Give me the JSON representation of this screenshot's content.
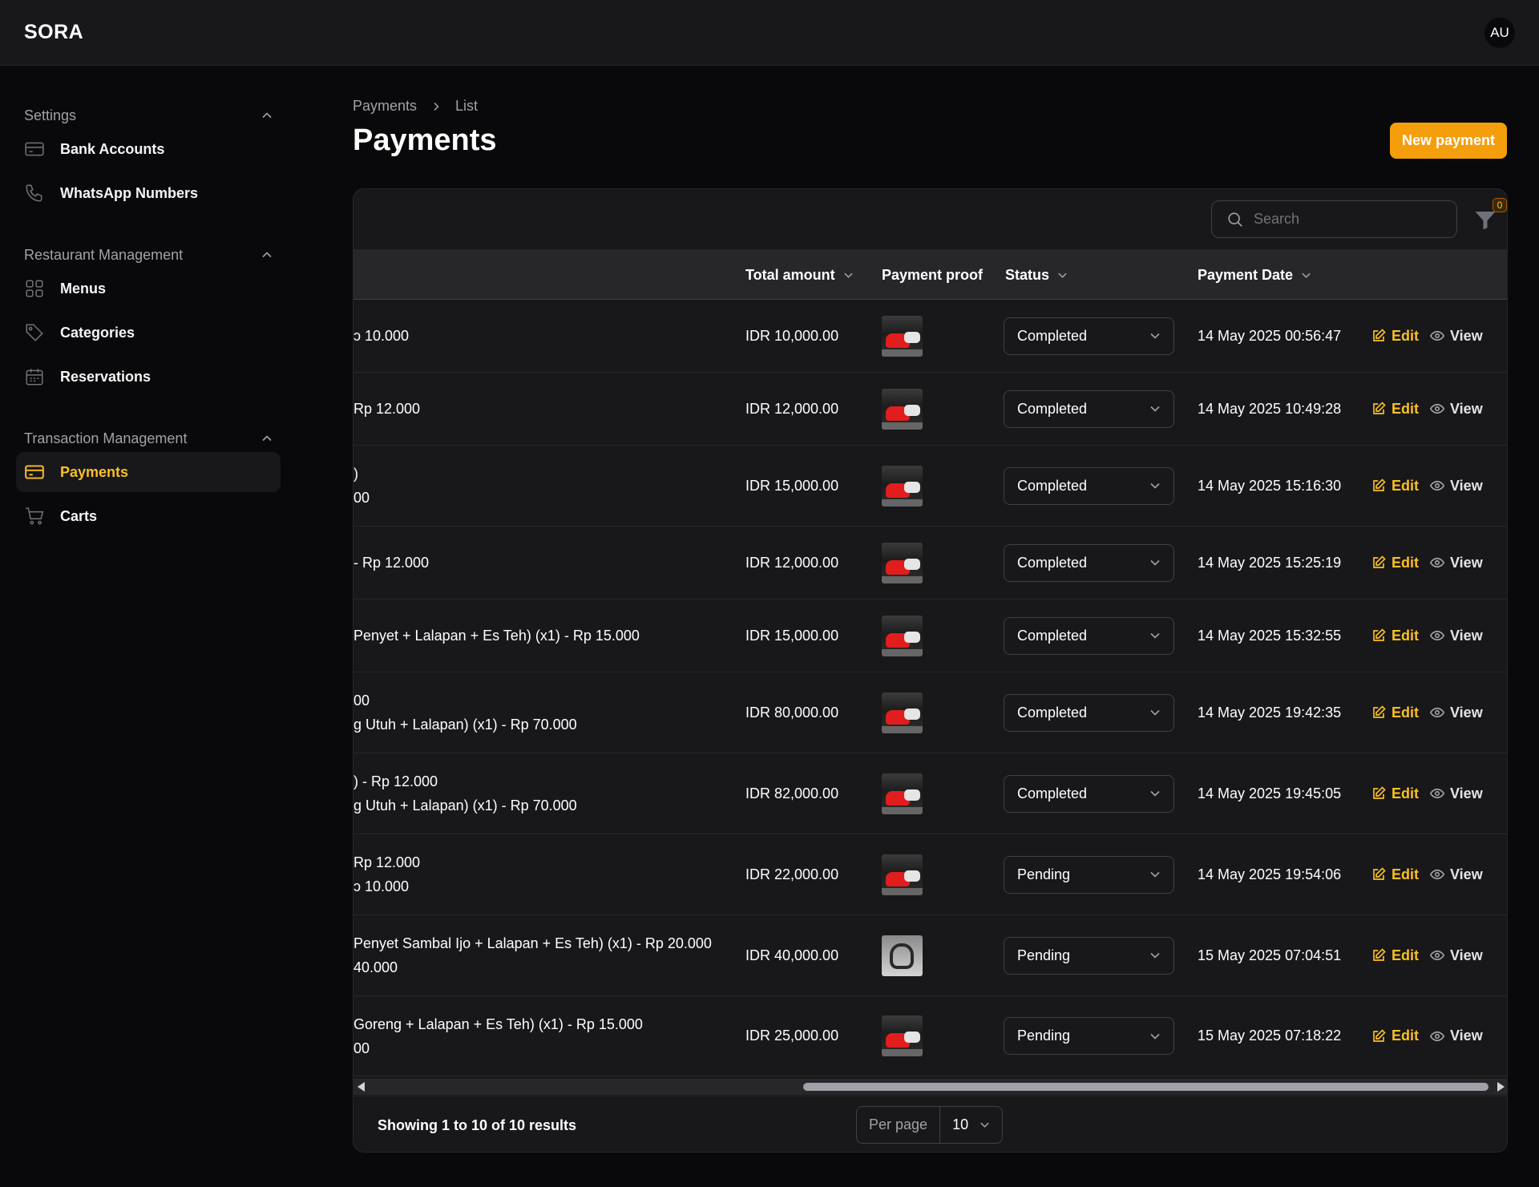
{
  "app": {
    "brand": "SORA",
    "user_initials": "AU"
  },
  "sidebar": {
    "groups": [
      {
        "label": "Settings",
        "items": [
          {
            "label": "Bank Accounts",
            "icon": "credit-card-icon"
          },
          {
            "label": "WhatsApp Numbers",
            "icon": "phone-icon"
          }
        ]
      },
      {
        "label": "Restaurant Management",
        "items": [
          {
            "label": "Menus",
            "icon": "grid-icon"
          },
          {
            "label": "Categories",
            "icon": "tag-icon"
          },
          {
            "label": "Reservations",
            "icon": "calendar-icon"
          }
        ]
      },
      {
        "label": "Transaction Management",
        "items": [
          {
            "label": "Payments",
            "icon": "credit-card-icon",
            "active": true
          },
          {
            "label": "Carts",
            "icon": "shopping-cart-icon"
          }
        ]
      }
    ]
  },
  "breadcrumb": {
    "parent": "Payments",
    "current": "List"
  },
  "page": {
    "title": "Payments",
    "new_button": "New payment"
  },
  "table": {
    "search_placeholder": "Search",
    "filter_count": "0",
    "columns": {
      "total_amount": "Total amount",
      "payment_proof": "Payment proof",
      "status": "Status",
      "payment_date": "Payment Date"
    },
    "actions": {
      "edit": "Edit",
      "view": "View"
    },
    "rows": [
      {
        "items": [
          "ɔ 10.000"
        ],
        "total": "IDR 10,000.00",
        "status": "Completed",
        "date": "14 May 2025 00:56:47",
        "proof": "car"
      },
      {
        "items": [
          "Rp 12.000"
        ],
        "total": "IDR 12,000.00",
        "status": "Completed",
        "date": "14 May 2025 10:49:28",
        "proof": "car"
      },
      {
        "items": [
          ")",
          "00"
        ],
        "total": "IDR 15,000.00",
        "status": "Completed",
        "date": "14 May 2025 15:16:30",
        "proof": "car"
      },
      {
        "items": [
          "- Rp 12.000"
        ],
        "total": "IDR 12,000.00",
        "status": "Completed",
        "date": "14 May 2025 15:25:19",
        "proof": "car"
      },
      {
        "items": [
          "Penyet + Lalapan + Es Teh) (x1) - Rp 15.000"
        ],
        "total": "IDR 15,000.00",
        "status": "Completed",
        "date": "14 May 2025 15:32:55",
        "proof": "car"
      },
      {
        "items": [
          "00",
          "g Utuh + Lalapan) (x1) - Rp 70.000"
        ],
        "total": "IDR 80,000.00",
        "status": "Completed",
        "date": "14 May 2025 19:42:35",
        "proof": "car"
      },
      {
        "items": [
          ") - Rp 12.000",
          "g Utuh + Lalapan) (x1) - Rp 70.000"
        ],
        "total": "IDR 82,000.00",
        "status": "Completed",
        "date": "14 May 2025 19:45:05",
        "proof": "car"
      },
      {
        "items": [
          "Rp 12.000",
          "ɔ 10.000"
        ],
        "total": "IDR 22,000.00",
        "status": "Pending",
        "date": "14 May 2025 19:54:06",
        "proof": "car"
      },
      {
        "items": [
          "Penyet Sambal Ijo + Lalapan + Es Teh) (x1) - Rp 20.000",
          "40.000"
        ],
        "total": "IDR 40,000.00",
        "status": "Pending",
        "date": "15 May 2025 07:04:51",
        "proof": "motorcycle"
      },
      {
        "items": [
          "Goreng + Lalapan + Es Teh) (x1) - Rp 15.000",
          "00"
        ],
        "total": "IDR 25,000.00",
        "status": "Pending",
        "date": "15 May 2025 07:18:22",
        "proof": "car"
      }
    ],
    "summary": "Showing 1 to 10 of 10 results",
    "per_page_label": "Per page",
    "per_page_value": "10"
  },
  "colors": {
    "accent": "#f59e0b",
    "accent_text": "#fbbf24",
    "background": "#09090b",
    "surface": "#18181b"
  }
}
